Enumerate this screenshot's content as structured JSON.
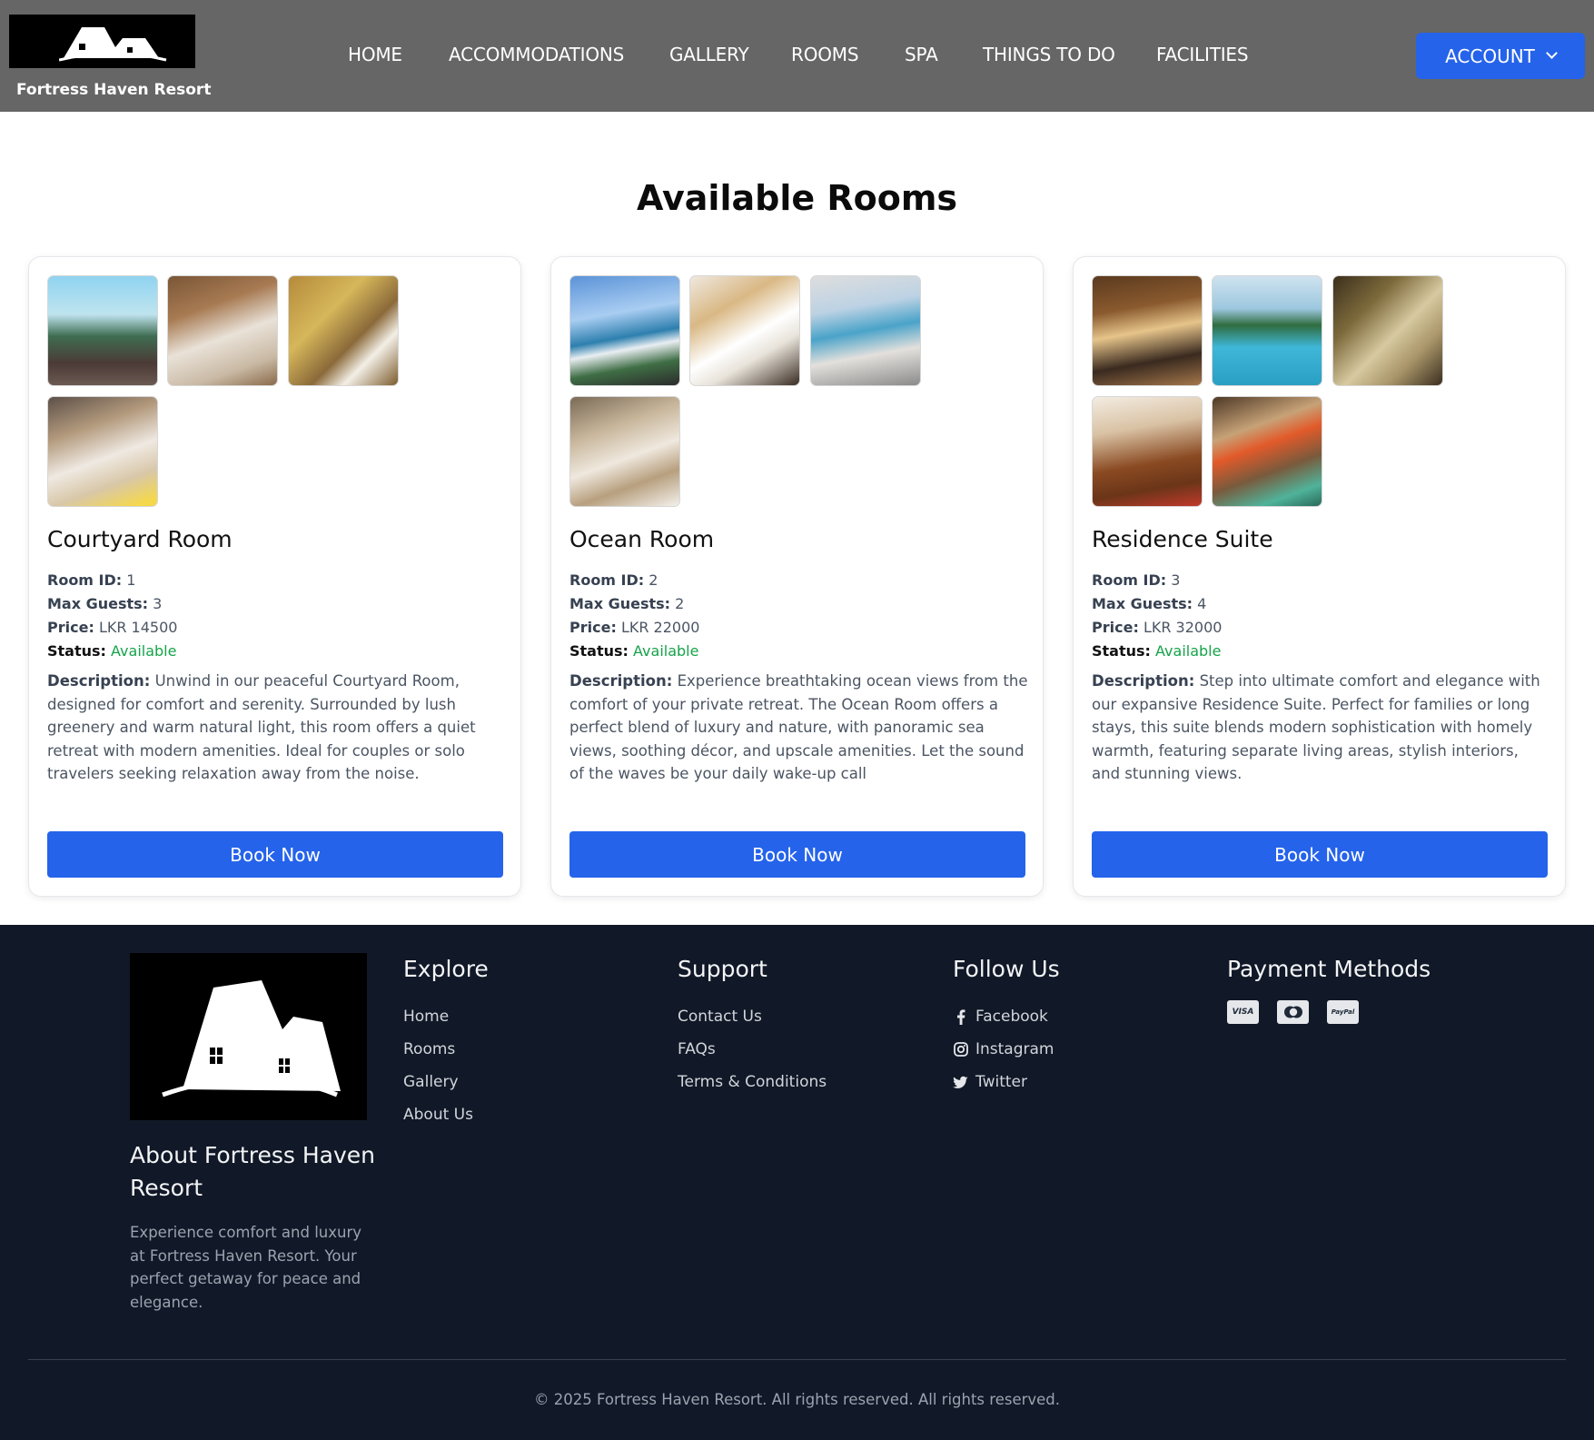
{
  "header": {
    "brand": "Fortress Haven Resort",
    "nav": [
      {
        "label": "HOME"
      },
      {
        "label": "ACCOMMODATIONS"
      },
      {
        "label": "GALLERY"
      },
      {
        "label": "ROOMS"
      },
      {
        "label": "SPA"
      },
      {
        "label": "THINGS TO DO"
      },
      {
        "label": "FACILITIES"
      }
    ],
    "account_label": "ACCOUNT",
    "accent_color": "#2563eb"
  },
  "main": {
    "title": "Available Rooms",
    "labels": {
      "room_id": "Room ID:",
      "max_guests": "Max Guests:",
      "price": "Price:",
      "status": "Status:",
      "description": "Description:"
    },
    "rooms": [
      {
        "name": "Courtyard Room",
        "room_id": "1",
        "max_guests": "3",
        "price": "LKR 14500",
        "status": "Available",
        "description": "Unwind in our peaceful Courtyard Room, designed for comfort and serenity. Surrounded by lush greenery and warm natural light, this room offers a quiet retreat with modern amenities. Ideal for couples or solo travelers seeking relaxation away from the noise.",
        "book_label": "Book Now",
        "photo_count": 4
      },
      {
        "name": "Ocean Room",
        "room_id": "2",
        "max_guests": "2",
        "price": "LKR 22000",
        "status": "Available",
        "description": "Experience breathtaking ocean views from the comfort of your private retreat. The Ocean Room offers a perfect blend of luxury and nature, with panoramic sea views, soothing décor, and upscale amenities. Let the sound of the waves be your daily wake-up call",
        "book_label": "Book Now",
        "photo_count": 4
      },
      {
        "name": "Residence Suite",
        "room_id": "3",
        "max_guests": "4",
        "price": "LKR 32000",
        "status": "Available",
        "description": "Step into ultimate comfort and elegance with our expansive Residence Suite. Perfect for families or long stays, this suite blends modern sophistication with homely warmth, featuring separate living areas, stylish interiors, and stunning views.",
        "book_label": "Book Now",
        "photo_count": 5
      }
    ]
  },
  "footer": {
    "about_title": "About Fortress Haven Resort",
    "about_text": "Experience comfort and luxury at Fortress Haven Resort. Your perfect getaway for peace and elegance.",
    "explore": {
      "title": "Explore",
      "links": [
        "Home",
        "Rooms",
        "Gallery",
        "About Us"
      ]
    },
    "support": {
      "title": "Support",
      "links": [
        "Contact Us",
        "FAQs",
        "Terms & Conditions"
      ]
    },
    "follow": {
      "title": "Follow Us",
      "links": [
        {
          "label": "Facebook",
          "icon": "facebook-icon"
        },
        {
          "label": "Instagram",
          "icon": "instagram-icon"
        },
        {
          "label": "Twitter",
          "icon": "twitter-icon"
        }
      ]
    },
    "payment": {
      "title": "Payment Methods",
      "methods": [
        {
          "label": "VISA",
          "icon": "visa-icon"
        },
        {
          "label": "",
          "icon": "mastercard-icon"
        },
        {
          "label": "PayPal",
          "icon": "paypal-icon"
        }
      ]
    },
    "copyright": "© 2025 Fortress Haven Resort. All rights reserved. All rights reserved.",
    "background_color": "#111827"
  }
}
